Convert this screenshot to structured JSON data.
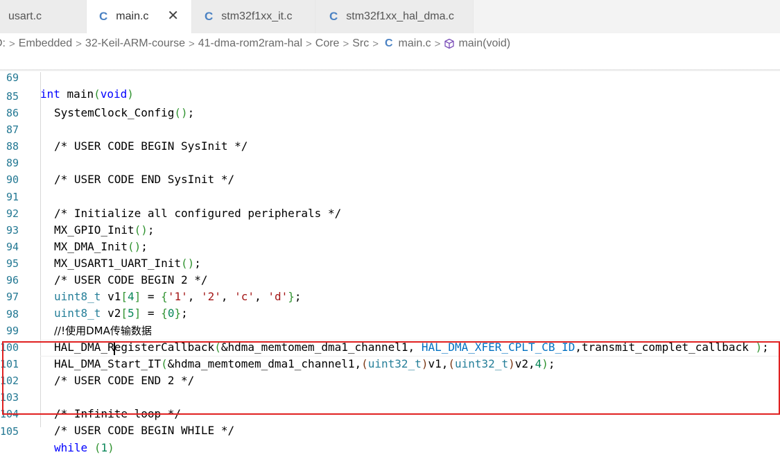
{
  "tabs": [
    {
      "label": "usart.c",
      "active": false
    },
    {
      "label": "main.c",
      "active": true,
      "close": "✕"
    },
    {
      "label": "stm32f1xx_it.c",
      "active": false
    },
    {
      "label": "stm32f1xx_hal_dma.c",
      "active": false
    }
  ],
  "file_icon_glyph": "C",
  "breadcrumb": {
    "items": [
      "D:",
      "Embedded",
      "32-Keil-ARM-course",
      "41-dma-rom2ram-hal",
      "Core",
      "Src",
      "main.c",
      "main(void)"
    ]
  },
  "lines": [
    {
      "num": "69",
      "text": "int main(void)"
    },
    {
      "num": "85",
      "text": "SystemClock_Config();"
    },
    {
      "num": "86",
      "text": ""
    },
    {
      "num": "87",
      "text": "/* USER CODE BEGIN SysInit */"
    },
    {
      "num": "88",
      "text": ""
    },
    {
      "num": "89",
      "text": "/* USER CODE END SysInit */"
    },
    {
      "num": "90",
      "text": ""
    },
    {
      "num": "91",
      "text": "/* Initialize all configured peripherals */"
    },
    {
      "num": "92",
      "text": "MX_GPIO_Init();"
    },
    {
      "num": "93",
      "text": "MX_DMA_Init();"
    },
    {
      "num": "94",
      "text": "MX_USART1_UART_Init();"
    },
    {
      "num": "95",
      "text": "/* USER CODE BEGIN 2 */"
    },
    {
      "num": "96",
      "text": "uint8_t v1[4] = {'1', '2', 'c', 'd'};"
    },
    {
      "num": "97",
      "text": "uint8_t v2[5] = {0};"
    },
    {
      "num": "98",
      "text": "//!使用DMA传输数据"
    },
    {
      "num": "99",
      "text": "HAL_DMA_RegisterCallback(&hdma_memtomem_dma1_channel1, HAL_DMA_XFER_CPLT_CB_ID,transmit_complet_callback );"
    },
    {
      "num": "100",
      "text": "HAL_DMA_Start_IT(&hdma_memtomem_dma1_channel1,(uint32_t)v1,(uint32_t)v2,4);"
    },
    {
      "num": "101",
      "text": "/* USER CODE END 2 */"
    },
    {
      "num": "102",
      "text": ""
    },
    {
      "num": "103",
      "text": "/* Infinite loop */"
    },
    {
      "num": "104",
      "text": "/* USER CODE BEGIN WHILE */"
    },
    {
      "num": "105",
      "text": "while (1)"
    }
  ],
  "colors": {
    "keyword": "#0000ff",
    "type": "#267f99",
    "comment": "#008000",
    "number": "#098658",
    "string": "#a31515",
    "enum": "#0070c1",
    "highlight_box": "#e02020",
    "line_number": "#237893"
  },
  "icons": {
    "c_file": "c-file-icon",
    "close": "close-icon",
    "method": "method-cube-icon",
    "chevron": "chevron-right-icon"
  }
}
